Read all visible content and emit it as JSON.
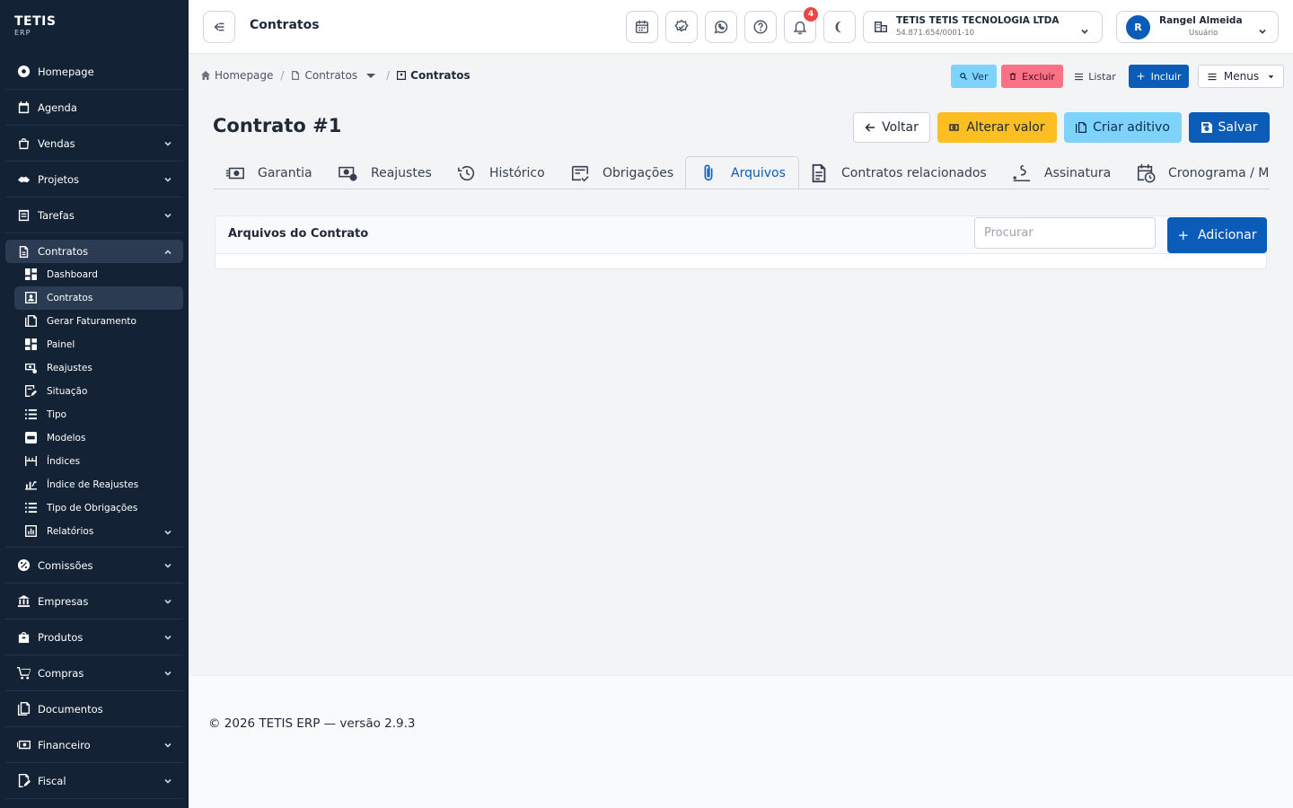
{
  "brand": {
    "name": "TETIS",
    "sub": "ERP"
  },
  "sidebar": {
    "items": [
      {
        "label": "Homepage"
      },
      {
        "label": "Agenda"
      },
      {
        "label": "Vendas"
      },
      {
        "label": "Projetos"
      },
      {
        "label": "Tarefas"
      },
      {
        "label": "Contratos"
      },
      {
        "label": "Comissões"
      },
      {
        "label": "Empresas"
      },
      {
        "label": "Produtos"
      },
      {
        "label": "Compras"
      },
      {
        "label": "Documentos"
      },
      {
        "label": "Financeiro"
      },
      {
        "label": "Fiscal"
      }
    ],
    "sub_items": [
      {
        "label": "Dashboard"
      },
      {
        "label": "Contratos"
      },
      {
        "label": "Gerar Faturamento"
      },
      {
        "label": "Painel"
      },
      {
        "label": "Reajustes"
      },
      {
        "label": "Situação"
      },
      {
        "label": "Tipo"
      },
      {
        "label": "Modelos"
      },
      {
        "label": "Índices"
      },
      {
        "label": "Índice de Reajustes"
      },
      {
        "label": "Tipo de Obrigações"
      },
      {
        "label": "Relatórios"
      }
    ]
  },
  "header": {
    "title": "Contratos",
    "notifications_count": "4",
    "company_name": "TETIS TETIS TECNOLOGIA LTDA",
    "company_cnpj": "54.871.654/0001-10",
    "user_initial": "R",
    "user_name": "Rangel Almeida",
    "user_role": "Usuário"
  },
  "breadcrumb": {
    "home": "Homepage",
    "parent": "Contratos",
    "current": "Contratos"
  },
  "toolbar": {
    "ver": "Ver",
    "excluir": "Excluir",
    "listar": "Listar",
    "incluir": "Incluir",
    "menus": "Menus"
  },
  "page": {
    "title": "Contrato #1"
  },
  "actions": {
    "voltar": "Voltar",
    "alterar": "Alterar valor",
    "aditivo": "Criar aditivo",
    "salvar": "Salvar"
  },
  "tabs": [
    {
      "label": "Garantia"
    },
    {
      "label": "Reajustes"
    },
    {
      "label": "Histórico"
    },
    {
      "label": "Obrigações"
    },
    {
      "label": "Arquivos"
    },
    {
      "label": "Contratos relacionados"
    },
    {
      "label": "Assinatura"
    },
    {
      "label": "Cronograma / M"
    }
  ],
  "files_card": {
    "title": "Arquivos do Contrato",
    "search_placeholder": "Procurar",
    "add_label": "Adicionar"
  },
  "footer": {
    "text": "© 2026 TETIS ERP — versão 2.9.3"
  },
  "colors": {
    "sidebar": "#132235",
    "primary": "#0b5cb8",
    "warning": "#fbbf24",
    "info": "#7dd3fc",
    "danger": "#fb7185"
  }
}
